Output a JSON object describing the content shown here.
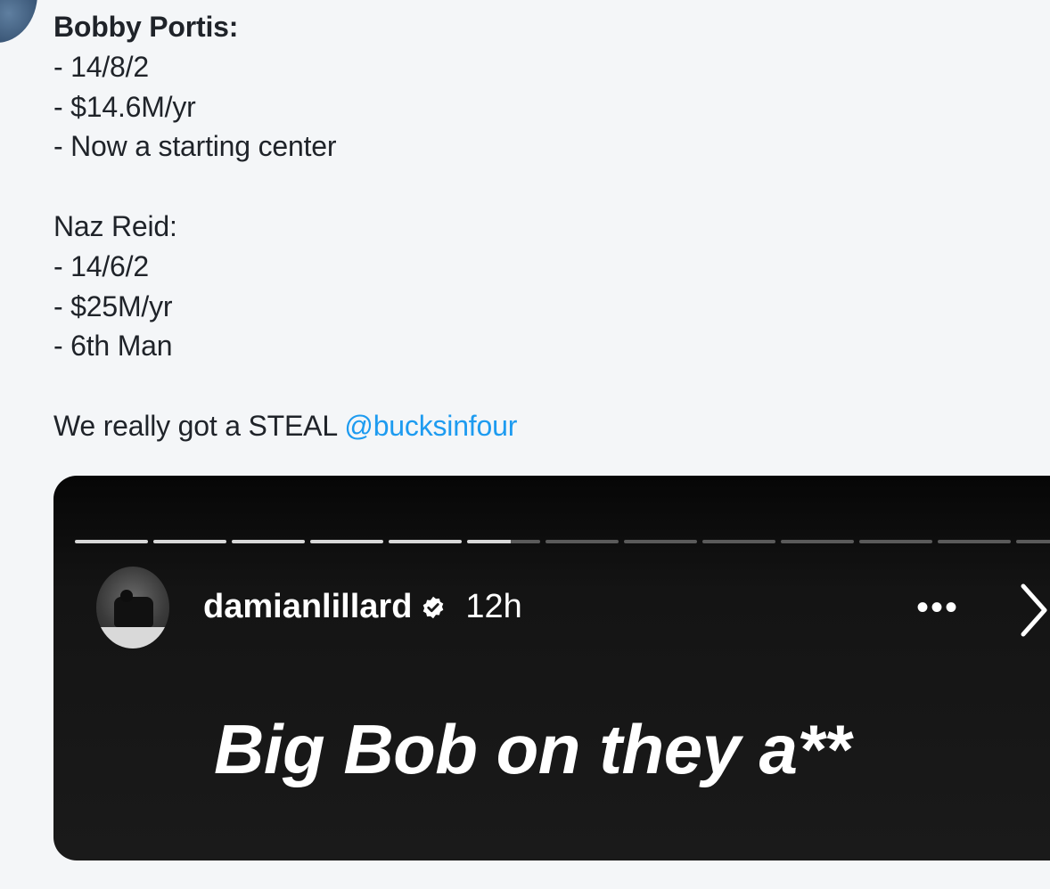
{
  "tweet": {
    "lines": [
      {
        "text": "Bobby Portis:",
        "bold": true
      },
      {
        "text": "- 14/8/2"
      },
      {
        "text": "- $14.6M/yr"
      },
      {
        "text": "- Now a starting center"
      },
      {
        "text": ""
      },
      {
        "text": "Naz Reid:"
      },
      {
        "text": "- 14/6/2"
      },
      {
        "text": "- $25M/yr"
      },
      {
        "text": "- 6th Man"
      },
      {
        "text": ""
      }
    ],
    "closing_text": "We really got a STEAL ",
    "mention": "@bucksinfour",
    "mention_color": "#1d9bf0"
  },
  "story": {
    "username": "damianlillard",
    "time": "12h",
    "more_label": "•••",
    "caption": "Big Bob on they a**",
    "progress": {
      "segments": 13,
      "completed": 5,
      "current_fraction": 0.6
    },
    "icons": {
      "verified": "verified-badge-icon",
      "more": "more-options-icon",
      "next": "chevron-right-icon"
    }
  }
}
